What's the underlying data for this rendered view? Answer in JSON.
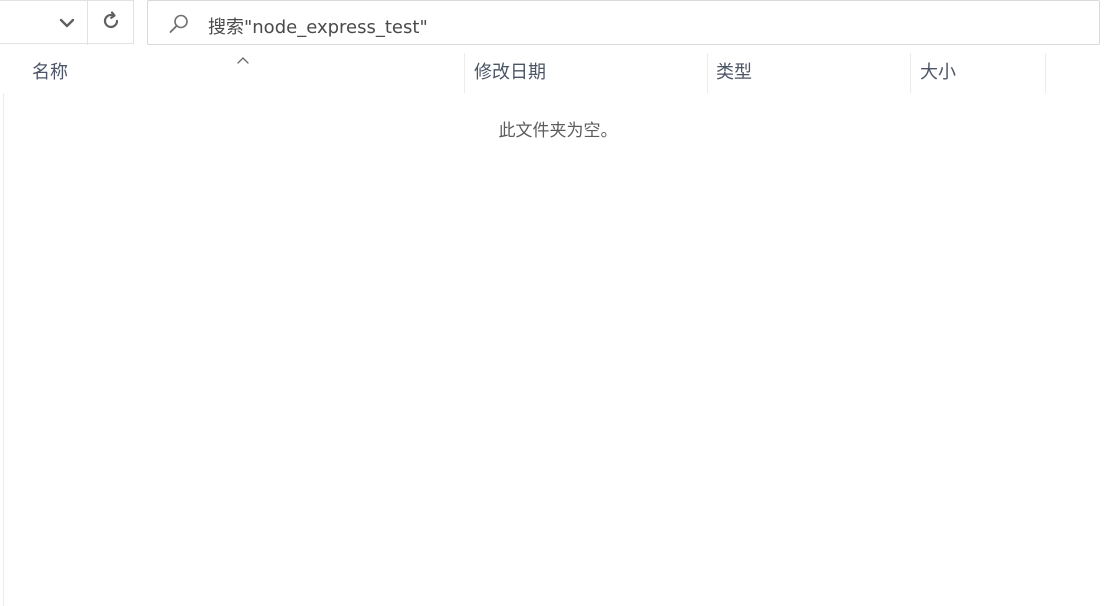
{
  "toolbar": {
    "dropdown_icon": "chevron-down-icon",
    "refresh_icon": "refresh-icon"
  },
  "search": {
    "icon": "search-icon",
    "text": "搜索\"node_express_test\""
  },
  "columns": [
    {
      "label": "名称",
      "sorted": "ascending"
    },
    {
      "label": "修改日期"
    },
    {
      "label": "类型"
    },
    {
      "label": "大小"
    }
  ],
  "main": {
    "empty_message": "此文件夹为空。"
  },
  "colors": {
    "header_text": "#4b5566",
    "border": "#e2e2e2",
    "icon": "#606060"
  }
}
